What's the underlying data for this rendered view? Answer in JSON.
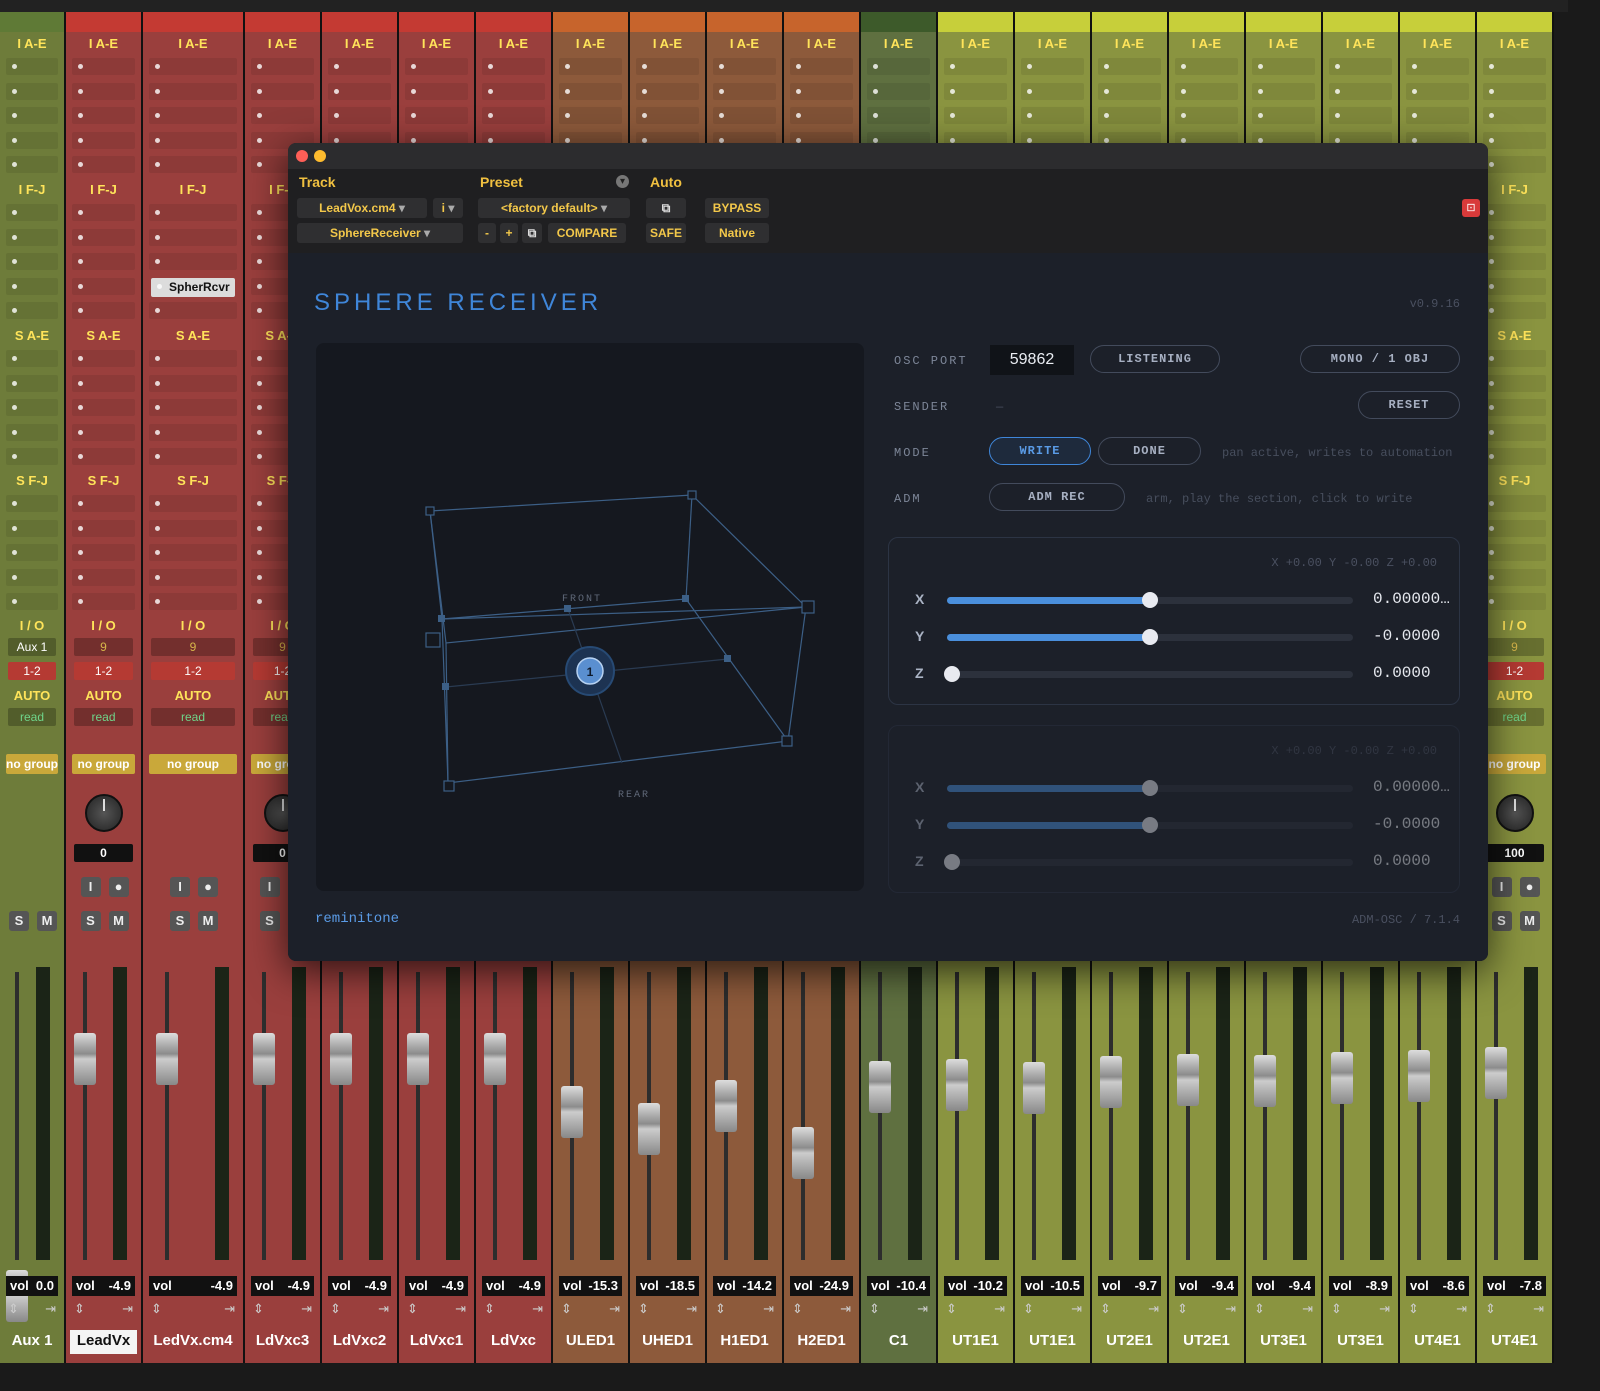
{
  "mixer": {
    "insert_labels": [
      "I A-E",
      "I F-J",
      "S A-E",
      "S F-J",
      "I / O"
    ],
    "insert_name": "SpherRcvr",
    "io_out": "1-2",
    "io_in": "Aux 1",
    "io_num": "9",
    "auto_label": "AUTO",
    "auto_mode": "read",
    "group": "no group",
    "pan_value_leadvx": "0",
    "pan_value_ut4e1": "100",
    "vol_label": "vol",
    "strips": [
      {
        "name": "Aux 1",
        "vol": "0.0",
        "color": "#6e7c3a"
      },
      {
        "name": "LeadVx",
        "vol": "-4.9",
        "color": "#9a3f3d"
      },
      {
        "name": "LedVx.cm4",
        "vol": "-4.9",
        "color": "#9a3f3d"
      },
      {
        "name": "LdVxc3",
        "vol": "-4.9",
        "color": "#9a3f3d"
      },
      {
        "name": "LdVxc2",
        "vol": "-4.9",
        "color": "#9a3f3d"
      },
      {
        "name": "LdVxc1",
        "vol": "-4.9",
        "color": "#9a3f3d"
      },
      {
        "name": "LdVxc",
        "vol": "-4.9",
        "color": "#9a3f3d"
      },
      {
        "name": "ULED1",
        "vol": "-15.3",
        "color": "#8d5a3b"
      },
      {
        "name": "UHED1",
        "vol": "-18.5",
        "color": "#8d5a3b"
      },
      {
        "name": "H1ED1",
        "vol": "-14.2",
        "color": "#8d5a3b"
      },
      {
        "name": "H2ED1",
        "vol": "-24.9",
        "color": "#8d5a3b"
      },
      {
        "name": "C1",
        "vol": "-10.4",
        "color": "#5f7040"
      },
      {
        "name": "UT1E1",
        "vol": "-10.2",
        "color": "#8a9440"
      },
      {
        "name": "UT1E1",
        "vol": "-10.5",
        "color": "#8a9440"
      },
      {
        "name": "UT2E1",
        "vol": "-9.7",
        "color": "#8a9440"
      },
      {
        "name": "UT2E1",
        "vol": "-9.4",
        "color": "#8a9440"
      },
      {
        "name": "UT3E1",
        "vol": "-9.4",
        "color": "#8a9440"
      },
      {
        "name": "UT3E1",
        "vol": "-8.9",
        "color": "#8a9440"
      },
      {
        "name": "UT4E1",
        "vol": "-8.6",
        "color": "#8a9440"
      },
      {
        "name": "UT4E1",
        "vol": "-7.8",
        "color": "#8a9440"
      }
    ]
  },
  "header": {
    "track_label": "Track",
    "preset_label": "Preset",
    "auto_label": "Auto",
    "track_name": "LeadVox.cm4",
    "track_index": "i",
    "insert_name": "SphereReceiver",
    "preset_value": "<factory default>",
    "minus": "-",
    "plus": "+",
    "compare": "COMPARE",
    "safe": "SAFE",
    "bypass": "BYPASS",
    "native": "Native"
  },
  "plugin": {
    "title": "SPHERE RECEIVER",
    "version": "v0.9.16",
    "front_label": "FRONT",
    "rear_label": "REAR",
    "object_number": "1",
    "osc_port_label": "OSC PORT",
    "osc_port_value": "59862",
    "listening": "LISTENING",
    "mono_obj": "MONO / 1 OBJ",
    "sender_label": "SENDER",
    "sender_value": "—",
    "reset": "RESET",
    "mode_label": "MODE",
    "write": "WRITE",
    "done": "DONE",
    "mode_hint": "pan active, writes to automation",
    "adm_label": "ADM",
    "adm_rec": "ADM REC",
    "adm_hint": "arm, play the section, click to write",
    "panel1": {
      "readout": "X +0.00  Y -0.00  Z +0.00",
      "x_value": "0.00000…",
      "y_value": "-0.0000",
      "z_value": "0.0000",
      "x_level": 0.5,
      "y_level": 0.5,
      "z_level": 0.0
    },
    "panel2": {
      "readout": "X +0.00  Y -0.00  Z +0.00",
      "x_value": "0.00000…",
      "y_value": "-0.0000",
      "z_value": "0.0000",
      "x_level": 0.5,
      "y_level": 0.5,
      "z_level": 0.0
    },
    "brand": "reminitone",
    "footer_right": "ADM-OSC / 7.1.4"
  },
  "colors": {
    "accent_blue": "#3f86d9",
    "label_yellow": "#ffe45a"
  }
}
